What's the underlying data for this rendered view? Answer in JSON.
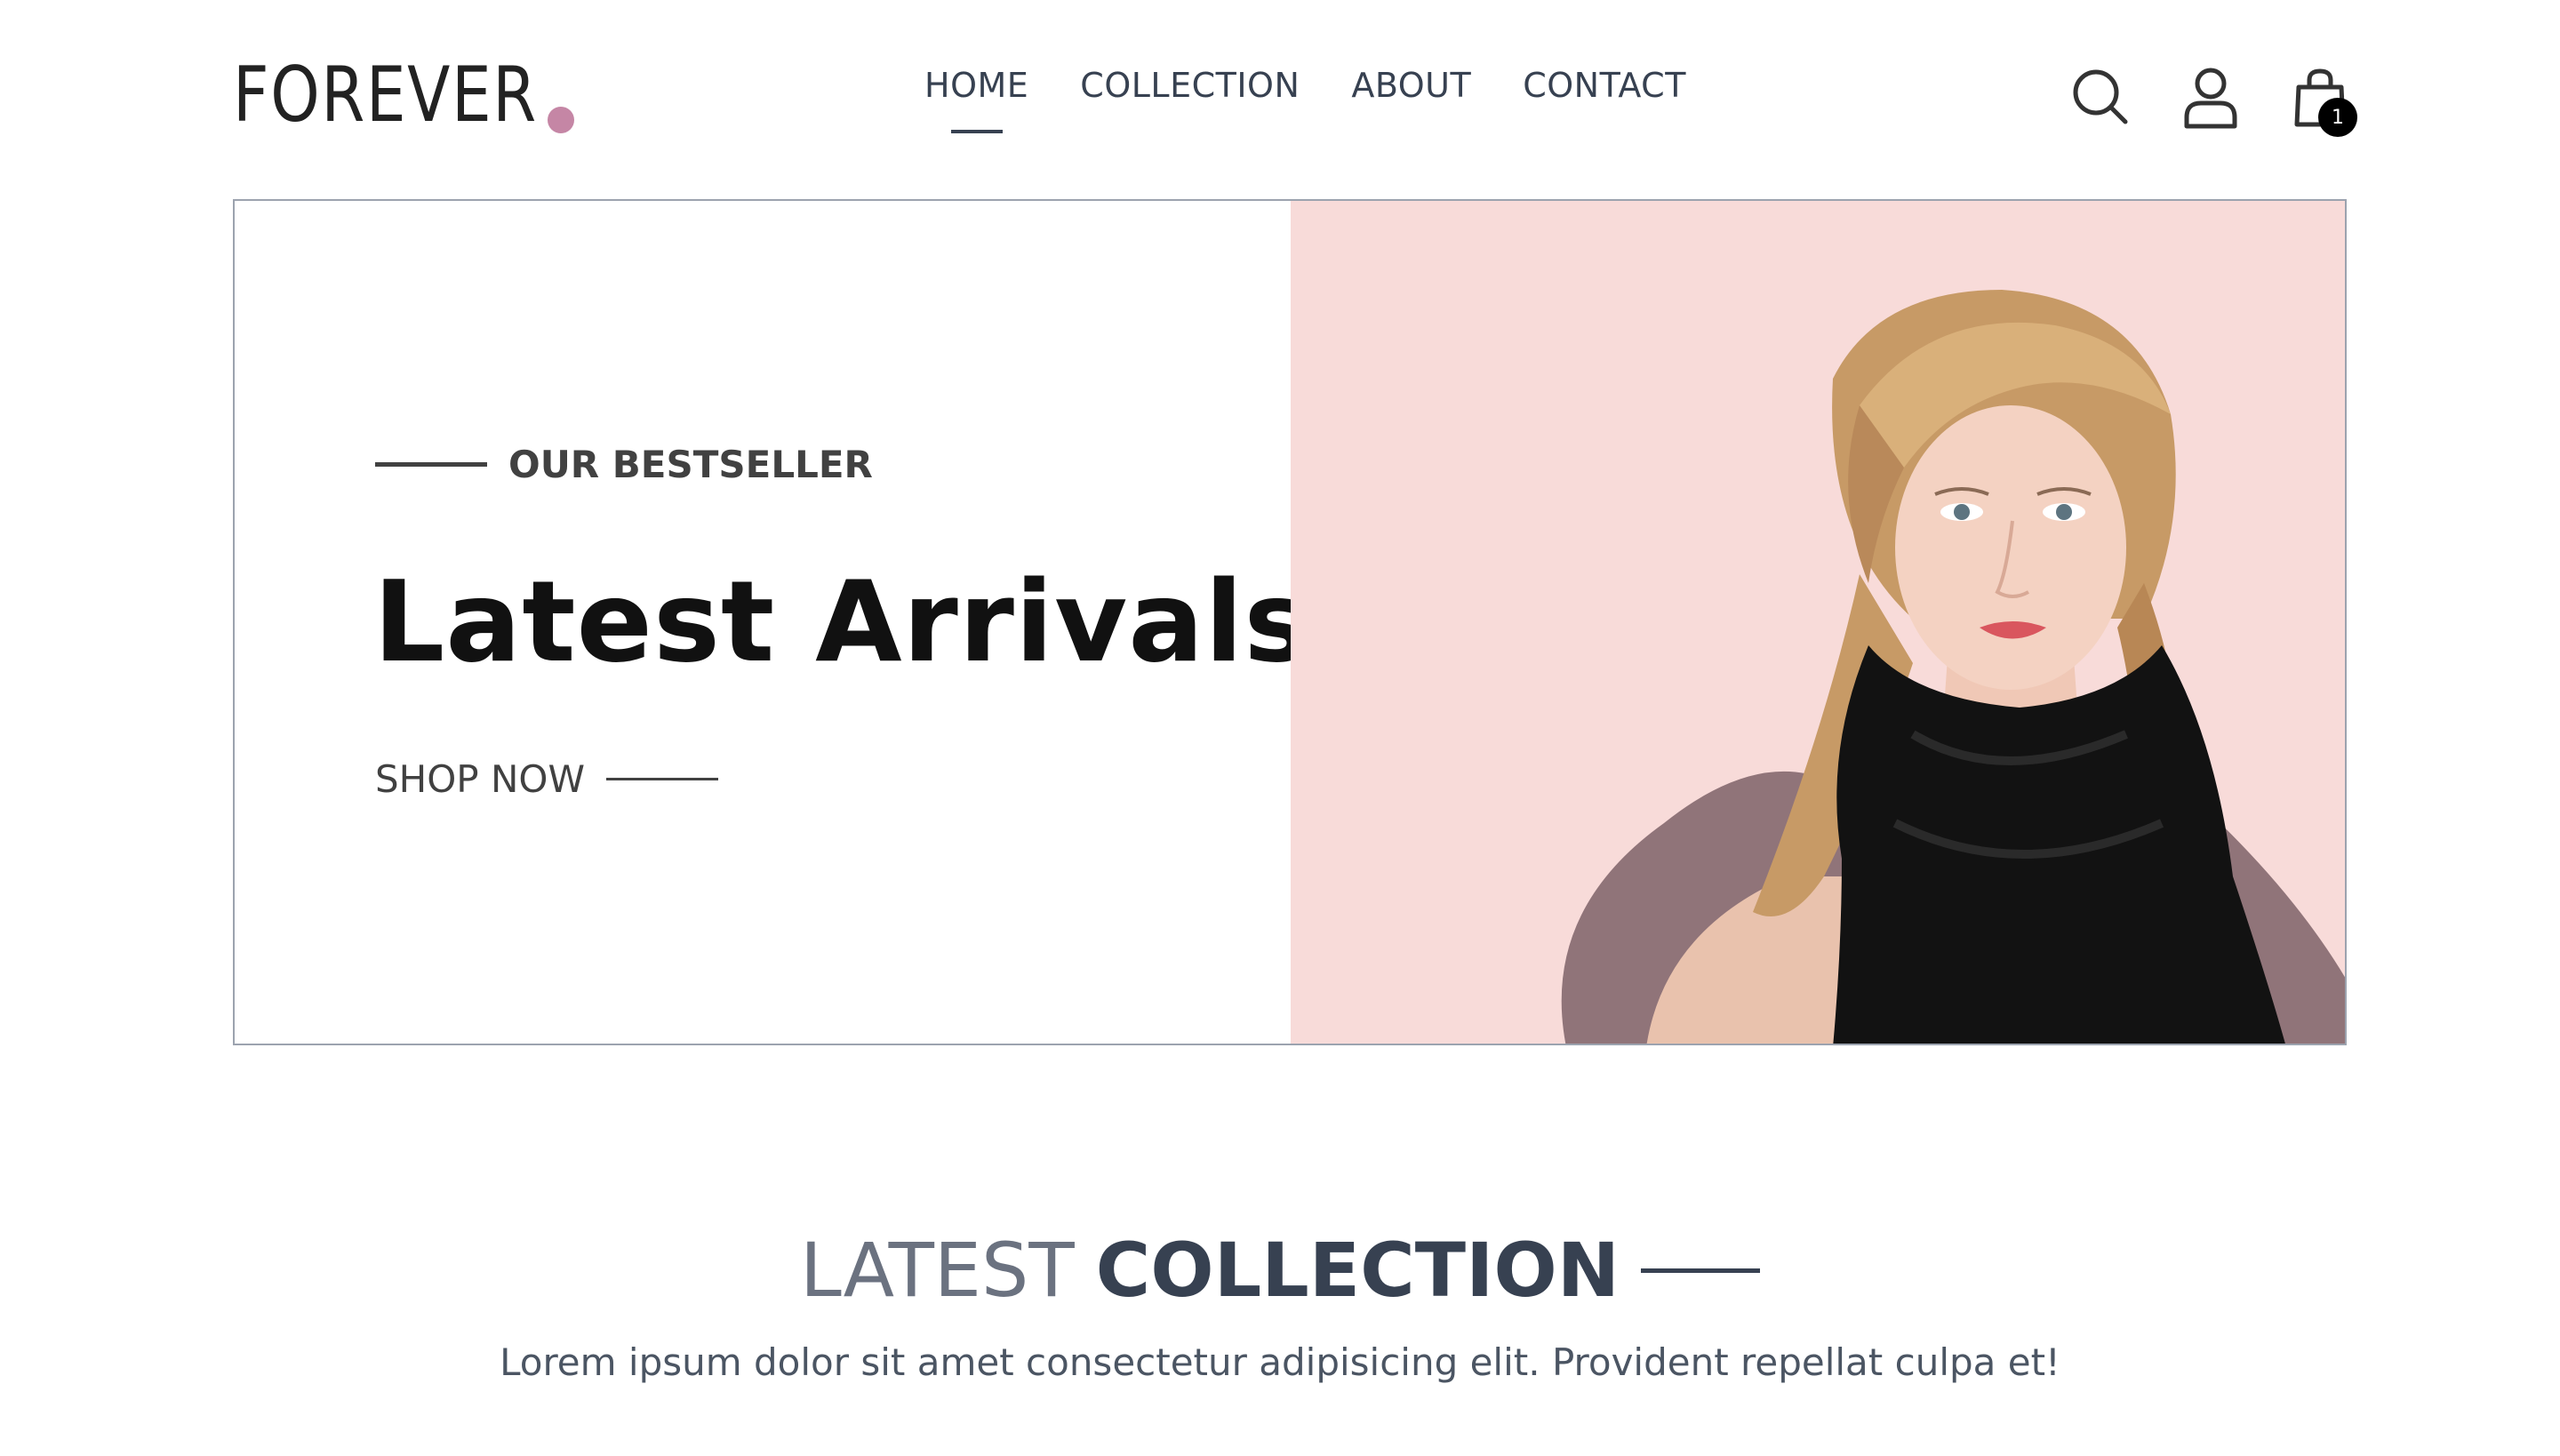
{
  "brand": {
    "logo_text": "FOREVER",
    "dot_color": "#c586a5"
  },
  "nav": {
    "items": [
      {
        "label": "HOME",
        "active": true
      },
      {
        "label": "COLLECTION",
        "active": false
      },
      {
        "label": "ABOUT",
        "active": false
      },
      {
        "label": "CONTACT",
        "active": false
      }
    ]
  },
  "header_icons": {
    "search": "search-icon",
    "profile": "profile-icon",
    "cart": "cart-icon",
    "cart_count": "1"
  },
  "hero": {
    "eyebrow": "OUR BESTSELLER",
    "title": "Latest Arrivals",
    "cta": "SHOP NOW",
    "image_bg": "#f8dbd9"
  },
  "collection": {
    "title_light": "LATEST",
    "title_dark": "COLLECTION",
    "subtitle": "Lorem ipsum dolor sit amet consectetur adipisicing elit. Provident repellat culpa et!"
  }
}
